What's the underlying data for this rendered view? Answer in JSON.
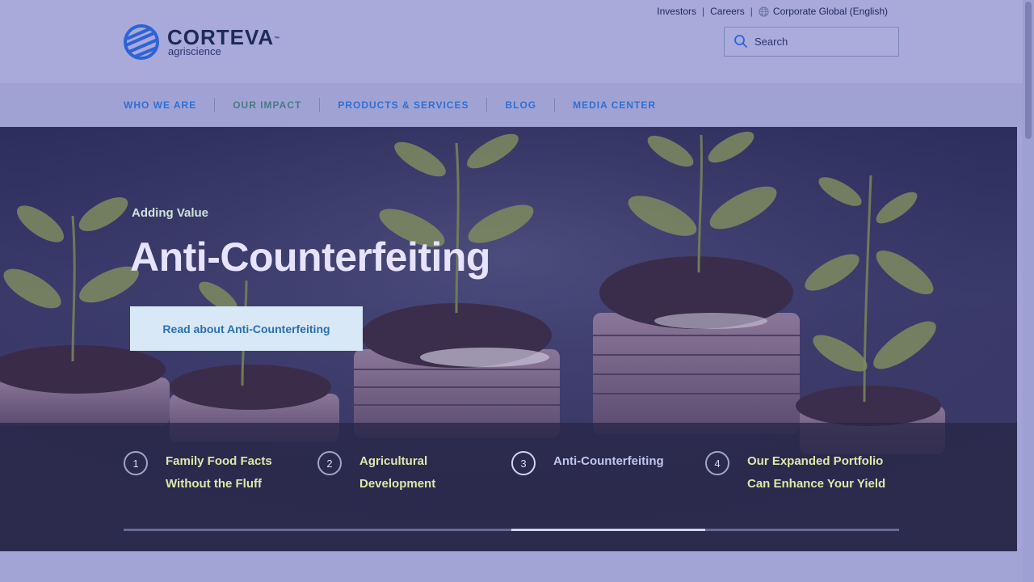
{
  "header": {
    "logo": {
      "wordmark": "CORTEVA",
      "trademark": "™",
      "subtitle": "agriscience"
    },
    "utility_links": [
      "Investors",
      "Careers",
      "Corporate Global (English)"
    ],
    "search": {
      "placeholder": "Search"
    }
  },
  "nav": {
    "items": [
      "WHO WE ARE",
      "OUR IMPACT",
      "PRODUCTS & SERVICES",
      "BLOG",
      "MEDIA CENTER"
    ]
  },
  "hero": {
    "eyebrow": "Adding Value",
    "title": "Anti-Counterfeiting",
    "cta_label": "Read about Anti-Counterfeiting"
  },
  "slides": {
    "items": [
      {
        "number": "1",
        "title": "Family Food Facts Without the Fluff"
      },
      {
        "number": "2",
        "title": "Agricultural Development"
      },
      {
        "number": "3",
        "title": "Anti-Counterfeiting"
      },
      {
        "number": "4",
        "title": "Our Expanded Portfolio Can Enhance Your Yield"
      }
    ],
    "active_index": 3,
    "total": 4
  },
  "colors": {
    "brand_navy": "#1d2a5a",
    "brand_blue": "#2e6fd3",
    "cta_background": "#d9e8f6"
  },
  "icons": {
    "logo": "corteva-logo-icon",
    "search": "search-icon",
    "globe": "globe-icon"
  }
}
